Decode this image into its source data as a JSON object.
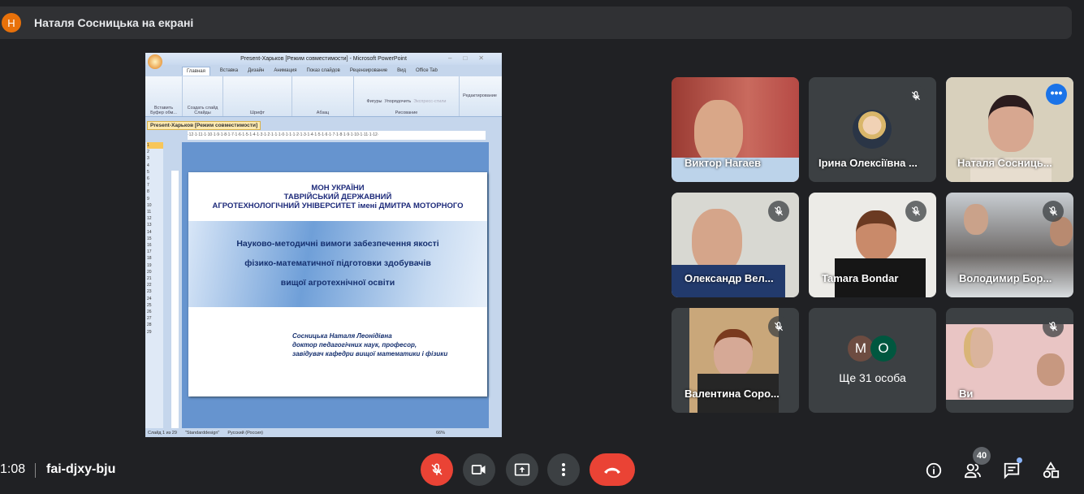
{
  "top_bar": {
    "avatar_letter": "Н",
    "title": "Наталя Сосницька на екрані"
  },
  "presentation": {
    "window_title": "Present-Харьков [Режим совместимости] - Microsoft PowerPoint",
    "ribbon_tabs": [
      "Главная",
      "Вставка",
      "Дизайн",
      "Анимация",
      "Показ слайдов",
      "Рецензирование",
      "Вид",
      "Office Tab"
    ],
    "ribbon_groups": [
      "Буфер обм...",
      "Слайды",
      "Шрифт",
      "Абзац",
      "Рисование",
      "Редактирование"
    ],
    "ribbon_buttons": [
      "Вставить",
      "Создать слайд",
      "Фигуры",
      "Упорядочить",
      "Экспресс-стили"
    ],
    "doc_tab": "Present-Харьков [Режим совместимости]",
    "ruler": "·12·1·11·1·10·1·9·1·8·1·7·1·6·1·5·1·4·1·3·1·2·1·1·1·0·1·1·1·2·1·3·1·4·1·5·1·6·1·7·1·8·1·9·1·10·1·11·1·12·",
    "slide_numbers": [
      "1",
      "2",
      "3",
      "4",
      "5",
      "6",
      "7",
      "8",
      "9",
      "10",
      "11",
      "12",
      "13",
      "14",
      "15",
      "16",
      "17",
      "18",
      "19",
      "20",
      "21",
      "22",
      "23",
      "24",
      "25",
      "26",
      "27",
      "28",
      "29"
    ],
    "slide": {
      "header": [
        "МОН УКРАЇНИ",
        "ТАВРІЙСЬКИЙ ДЕРЖАВНИЙ",
        "АГРОТЕХНОЛОГІЧНИЙ УНІВЕРСИТЕТ імені ДМИТРА МОТОРНОГО"
      ],
      "title": [
        "Науково-методичні вимоги забезпечення якості",
        "фізико-математичної підготовки здобувачів",
        "вищої агротехнічної освіти"
      ],
      "author": [
        "Сосницька Наталя Леонідівна",
        "доктор педагогічних наук, професор,",
        "завідувач кафедри вищої математики і фізики"
      ]
    },
    "status": {
      "slide": "Слайд 1 из 29",
      "design": "\"Standarddesign\"",
      "language": "Русский (Россия)",
      "zoom": "66%"
    }
  },
  "participants": [
    {
      "name": "Виктор Нагаев",
      "muted": false
    },
    {
      "name": "Ірина Олексіївна ...",
      "muted": true
    },
    {
      "name": "Наталя Сосниць...",
      "muted": false,
      "active": true
    },
    {
      "name": "Олександр Вел...",
      "muted": true
    },
    {
      "name": "Tamara Bondar",
      "muted": true
    },
    {
      "name": "Володимир Бор...",
      "muted": true
    },
    {
      "name": "Валентина Соро...",
      "muted": true
    },
    {
      "name": "Ще 31 особа",
      "avatars": [
        "М",
        "О"
      ]
    },
    {
      "name": "Ви",
      "muted": true
    }
  ],
  "bottom_bar": {
    "time": "1:08",
    "meeting_code": "fai-djxy-bju",
    "participant_count": "40"
  },
  "colors": {
    "end_call": "#ea4335",
    "accent": "#8ab4f8",
    "background": "#202124"
  }
}
